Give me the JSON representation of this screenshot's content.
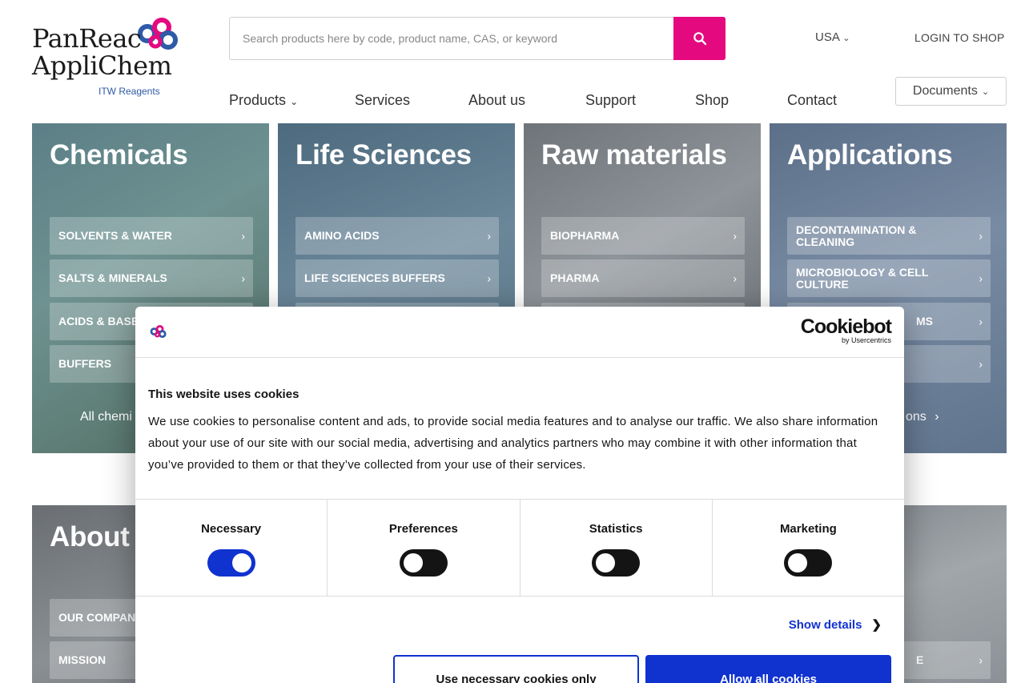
{
  "brand": {
    "line1": "PanReac",
    "line2": "AppliChem",
    "tagline": "ITW Reagents"
  },
  "header": {
    "search_placeholder": "Search products here by code, product name, CAS, or keyword",
    "search_icon": "search-icon",
    "country": "USA",
    "login": "LOGIN TO SHOP",
    "documents": "Documents"
  },
  "nav": [
    "Products",
    "Services",
    "About us",
    "Support",
    "Shop",
    "Contact"
  ],
  "panels": [
    {
      "title": "Chemicals",
      "items": [
        "SOLVENTS & WATER",
        "SALTS & MINERALS",
        "ACIDS & BASE",
        "BUFFERS"
      ],
      "all": "All chemi"
    },
    {
      "title": "Life Sciences",
      "items": [
        "AMINO ACIDS",
        "LIFE SCIENCES BUFFERS"
      ]
    },
    {
      "title": "Raw materials",
      "items": [
        "BIOPHARMA",
        "PHARMA"
      ]
    },
    {
      "title": "Applications",
      "items": [
        "DECONTAMINATION & CLEANING",
        "MICROBIOLOGY & CELL CULTURE",
        "MS",
        ""
      ],
      "all": "ons"
    },
    {
      "title": "About",
      "items": [
        "OUR COMPAN",
        "MISSION"
      ]
    },
    {
      "items": [
        "E"
      ]
    }
  ],
  "cookie": {
    "brand": "Cookiebot",
    "brand_sub": "by Usercentrics",
    "heading": "This website uses cookies",
    "body": "We use cookies to personalise content and ads, to provide social media features and to analyse our traffic. We also share information about your use of our site with our social media, advertising and analytics partners who may combine it with other information that you’ve provided to them or that they’ve collected from your use of their services.",
    "categories": [
      {
        "label": "Necessary",
        "enabled": true
      },
      {
        "label": "Preferences",
        "enabled": false
      },
      {
        "label": "Statistics",
        "enabled": false
      },
      {
        "label": "Marketing",
        "enabled": false
      }
    ],
    "show_details": "Show details",
    "btn_necessary": "Use necessary cookies only",
    "btn_all": "Allow all cookies"
  },
  "colors": {
    "accent": "#e5097f",
    "cookie_blue": "#1032cf",
    "text": "#141414"
  }
}
